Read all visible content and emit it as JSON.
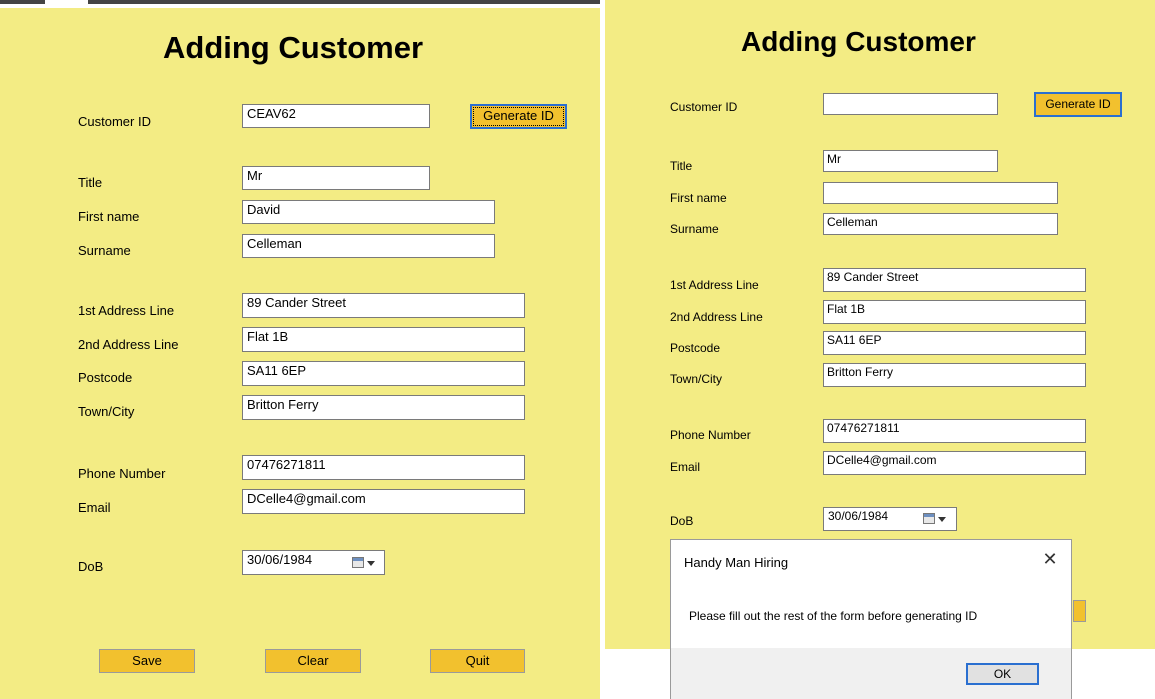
{
  "left": {
    "title": "Adding Customer",
    "labels": {
      "customer_id": "Customer ID",
      "title": "Title",
      "first_name": "First name",
      "surname": "Surname",
      "address1": "1st Address Line",
      "address2": "2nd Address Line",
      "postcode": "Postcode",
      "town": "Town/City",
      "phone": "Phone Number",
      "email": "Email",
      "dob": "DoB"
    },
    "values": {
      "customer_id": "CEAV62",
      "title": "Mr",
      "first_name": "David",
      "surname": "Celleman",
      "address1": "89 Cander Street",
      "address2": "Flat 1B",
      "postcode": "SA11 6EP",
      "town": "Britton Ferry",
      "phone": "07476271811",
      "email": "DCelle4@gmail.com",
      "dob": "30/06/1984"
    },
    "buttons": {
      "generate": "Generate ID",
      "save": "Save",
      "clear": "Clear",
      "quit": "Quit"
    }
  },
  "right": {
    "title": "Adding Customer",
    "labels": {
      "customer_id": "Customer ID",
      "title": "Title",
      "first_name": "First name",
      "surname": "Surname",
      "address1": "1st Address Line",
      "address2": "2nd Address Line",
      "postcode": "Postcode",
      "town": "Town/City",
      "phone": "Phone Number",
      "email": "Email",
      "dob": "DoB"
    },
    "values": {
      "customer_id": "",
      "title": "Mr",
      "first_name": "",
      "surname": "Celleman",
      "address1": "89 Cander Street",
      "address2": "Flat 1B",
      "postcode": "SA11 6EP",
      "town": "Britton Ferry",
      "phone": "07476271811",
      "email": "DCelle4@gmail.com",
      "dob": "30/06/1984"
    },
    "buttons": {
      "generate": "Generate ID"
    }
  },
  "dialog": {
    "title": "Handy Man Hiring",
    "close_glyph": "✕",
    "message": "Please fill out the rest of the form before generating ID",
    "ok": "OK"
  },
  "colors": {
    "form_background": "#f3ec84",
    "button": "#f2c12e",
    "focus_border": "#2a6fd0"
  },
  "icons": [
    "calendar-icon",
    "dropdown-arrow-icon",
    "close-icon"
  ]
}
